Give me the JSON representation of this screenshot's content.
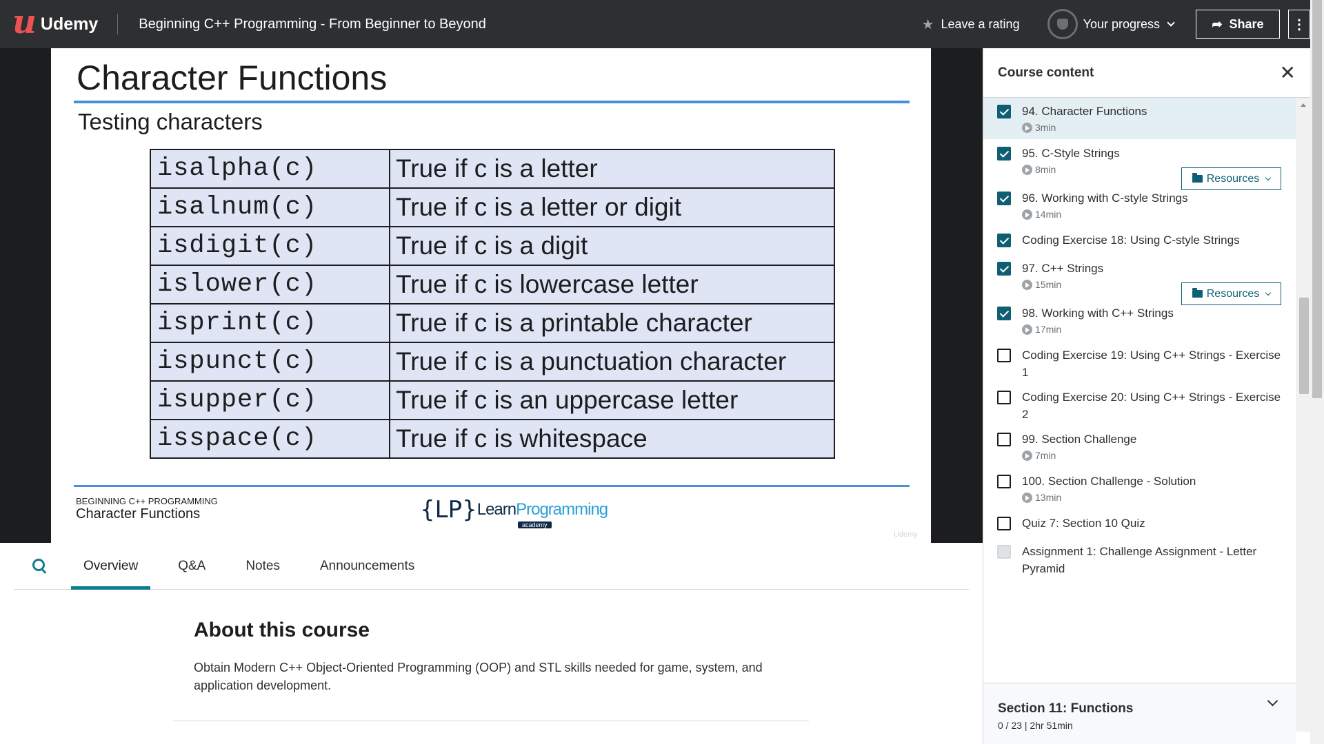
{
  "header": {
    "logo_mark": "u",
    "logo_text": "Udemy",
    "course_title": "Beginning C++ Programming - From Beginner to Beyond",
    "rating_label": "Leave a rating",
    "progress_label": "Your progress",
    "share_label": "Share",
    "more_label": "⋮"
  },
  "slide": {
    "title": "Character Functions",
    "subtitle": "Testing characters",
    "rows": [
      {
        "fn": "isalpha(c)",
        "desc": "True if c is a letter"
      },
      {
        "fn": "isalnum(c)",
        "desc": "True if c is a letter or digit"
      },
      {
        "fn": "isdigit(c)",
        "desc": "True if c is a digit"
      },
      {
        "fn": "islower(c)",
        "desc": "True if c is lowercase letter"
      },
      {
        "fn": "isprint(c)",
        "desc": "True if c is a printable character"
      },
      {
        "fn": "ispunct(c)",
        "desc": "True if c is a punctuation character"
      },
      {
        "fn": "isupper(c)",
        "desc": "True if c is an uppercase letter"
      },
      {
        "fn": "isspace(c)",
        "desc": "True if c is whitespace"
      }
    ],
    "footer_small": "Beginning C++ Programming",
    "footer_main": "Character Functions",
    "lpa_brace": "{LP}",
    "lpa_learn": "Learn",
    "lpa_programming": "Programming",
    "lpa_academy": "academy",
    "watermark": "Udemy"
  },
  "tabs": [
    {
      "label": "Overview",
      "active": true
    },
    {
      "label": "Q&A",
      "active": false
    },
    {
      "label": "Notes",
      "active": false
    },
    {
      "label": "Announcements",
      "active": false
    }
  ],
  "about": {
    "title": "About this course",
    "description": "Obtain Modern C++ Object-Oriented Programming (OOP) and STL skills needed for game, system, and application development."
  },
  "sidebar": {
    "title": "Course content",
    "close_label": "✕",
    "resources_label": "Resources",
    "lectures": [
      {
        "title": "94. Character Functions",
        "duration": "3min",
        "checked": true
      },
      {
        "title": "95. C-Style Strings",
        "duration": "8min",
        "checked": true,
        "resources": true
      },
      {
        "title": "96. Working with C-style Strings",
        "duration": "14min",
        "checked": true
      },
      {
        "title": "Coding Exercise 18: Using C-style Strings",
        "duration": "",
        "checked": true
      },
      {
        "title": "97. C++ Strings",
        "duration": "15min",
        "checked": true,
        "resources": true
      },
      {
        "title": "98. Working with C++ Strings",
        "duration": "17min",
        "checked": true
      },
      {
        "title": "Coding Exercise 19: Using C++ Strings - Exercise 1",
        "duration": "",
        "checked": false
      },
      {
        "title": "Coding Exercise 20: Using C++ Strings - Exercise 2",
        "duration": "",
        "checked": false
      },
      {
        "title": "99. Section Challenge",
        "duration": "7min",
        "checked": false
      },
      {
        "title": "100. Section Challenge - Solution",
        "duration": "13min",
        "checked": false
      },
      {
        "title": "Quiz 7: Section 10 Quiz",
        "duration": "",
        "checked": false
      },
      {
        "title": "Assignment 1: Challenge Assignment - Letter Pyramid",
        "duration": "",
        "checked": false,
        "disabled": true
      }
    ],
    "next_section": {
      "title": "Section 11: Functions",
      "meta": "0 / 23 | 2hr 51min"
    }
  },
  "colors": {
    "header_bg": "#2d2f31",
    "accent": "#0f7c90",
    "checkbox": "#0e5f74",
    "slide_rule": "#4a90d9",
    "table_cell": "#dfe5f5",
    "logo": "#ec5252"
  }
}
